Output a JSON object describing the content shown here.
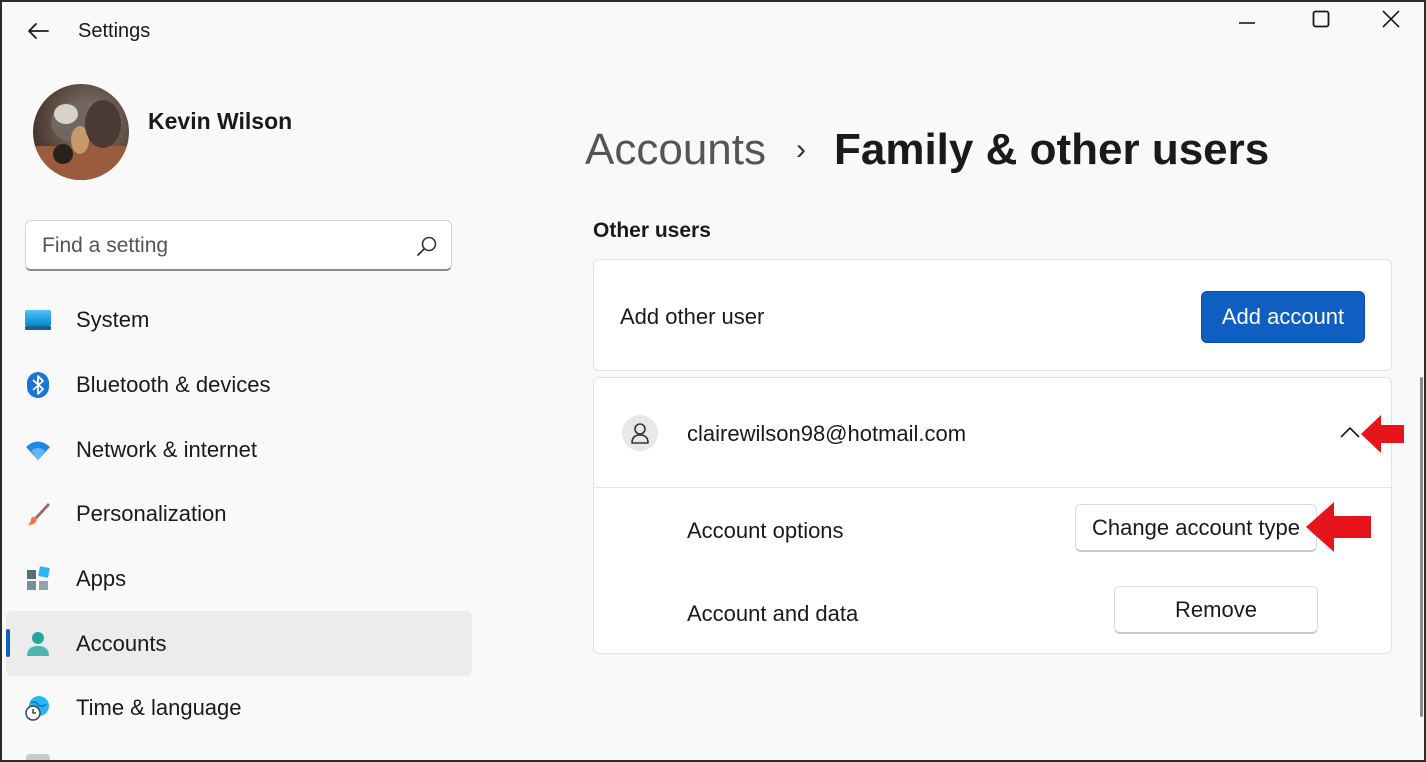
{
  "window": {
    "title": "Settings",
    "controls": [
      "minimize",
      "maximize",
      "close"
    ]
  },
  "profile": {
    "name": "Kevin Wilson"
  },
  "search": {
    "placeholder": "Find a setting",
    "icon": "search-icon"
  },
  "sidebar": {
    "items": [
      {
        "label": "System",
        "icon": "system-icon",
        "active": false
      },
      {
        "label": "Bluetooth & devices",
        "icon": "bluetooth-icon",
        "active": false
      },
      {
        "label": "Network & internet",
        "icon": "wifi-icon",
        "active": false
      },
      {
        "label": "Personalization",
        "icon": "brush-icon",
        "active": false
      },
      {
        "label": "Apps",
        "icon": "apps-icon",
        "active": false
      },
      {
        "label": "Accounts",
        "icon": "accounts-icon",
        "active": true
      },
      {
        "label": "Time & language",
        "icon": "globe-clock-icon",
        "active": false
      }
    ]
  },
  "breadcrumb": {
    "parent": "Accounts",
    "separator": "›",
    "current": "Family & other users"
  },
  "main": {
    "section_title": "Other users",
    "add_user": {
      "label": "Add other user",
      "button": "Add account"
    },
    "user": {
      "email": "clairewilson98@hotmail.com",
      "expanded": true,
      "options": [
        {
          "label": "Account options",
          "button": "Change account type"
        },
        {
          "label": "Account and data",
          "button": "Remove"
        }
      ]
    }
  },
  "colors": {
    "accent": "#0f5fc2",
    "annotation_arrow": "#e8141c"
  }
}
